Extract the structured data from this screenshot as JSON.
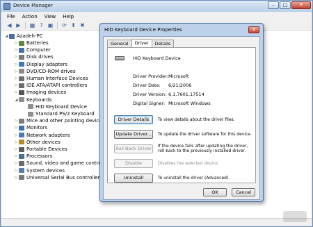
{
  "window": {
    "title": "Device Manager"
  },
  "menu": [
    "File",
    "Action",
    "View",
    "Help"
  ],
  "toolbar": {
    "icons": [
      "back-icon",
      "forward-icon",
      "properties-icon",
      "help-icon",
      "computer-icon",
      "scan-icon",
      "update-icon",
      "disable-icon"
    ]
  },
  "tree": {
    "root": "Azadeh-PC",
    "items": [
      {
        "label": "Batteries",
        "icon": "battery-icon",
        "color": "#5a8a3a",
        "expanded": false
      },
      {
        "label": "Computer",
        "icon": "computer-icon",
        "color": "#4a6fa5",
        "expanded": false
      },
      {
        "label": "Disk drives",
        "icon": "disk-icon",
        "color": "#7a7a7a",
        "expanded": false
      },
      {
        "label": "Display adapters",
        "icon": "display-icon",
        "color": "#3e7ab8",
        "expanded": false
      },
      {
        "label": "DVD/CD-ROM drives",
        "icon": "dvd-icon",
        "color": "#8a8a8a",
        "expanded": false
      },
      {
        "label": "Human Interface Devices",
        "icon": "hid-icon",
        "color": "#6e6e6e",
        "expanded": false
      },
      {
        "label": "IDE ATA/ATAPI controllers",
        "icon": "ide-icon",
        "color": "#6b6b6b",
        "expanded": false
      },
      {
        "label": "Imaging devices",
        "icon": "camera-icon",
        "color": "#555555",
        "expanded": false
      },
      {
        "label": "Keyboards",
        "icon": "keyboard-icon",
        "color": "#8f8f8f",
        "expanded": true
      },
      {
        "label": "HID Keyboard Device",
        "icon": "keyboard-icon",
        "color": "#8f8f8f",
        "child": true
      },
      {
        "label": "Standard PS/2 Keyboard",
        "icon": "keyboard-icon",
        "color": "#8f8f8f",
        "child": true
      },
      {
        "label": "Mice and other pointing devices",
        "icon": "mouse-icon",
        "color": "#7c7c7c",
        "expanded": false
      },
      {
        "label": "Monitors",
        "icon": "monitor-icon",
        "color": "#3f6fa8",
        "expanded": false
      },
      {
        "label": "Network adapters",
        "icon": "network-icon",
        "color": "#4b7bb3",
        "expanded": false
      },
      {
        "label": "Other devices",
        "icon": "other-devices-icon",
        "color": "#b08a2e",
        "expanded": false
      },
      {
        "label": "Portable Devices",
        "icon": "portable-icon",
        "color": "#5c5c5c",
        "expanded": false
      },
      {
        "label": "Processors",
        "icon": "processor-icon",
        "color": "#4d6f8f",
        "expanded": false
      },
      {
        "label": "Sound, video and game controllers",
        "icon": "sound-icon",
        "color": "#6a6a6a",
        "expanded": false
      },
      {
        "label": "System devices",
        "icon": "system-icon",
        "color": "#5a7ea8",
        "expanded": false
      },
      {
        "label": "Universal Serial Bus controllers",
        "icon": "usb-icon",
        "color": "#7a7a7a",
        "expanded": false
      }
    ]
  },
  "dialog": {
    "title": "HID Keyboard Device Properties",
    "tabs": [
      "General",
      "Driver",
      "Details"
    ],
    "active_tab": "Driver",
    "device_name": "HID Keyboard Device",
    "properties": [
      {
        "label": "Driver Provider:",
        "value": "Microsoft"
      },
      {
        "label": "Driver Date:",
        "value": "6/21/2006"
      },
      {
        "label": "Driver Version:",
        "value": "6.1.7601.17514"
      },
      {
        "label": "Digital Signer:",
        "value": "Microsoft Windows"
      }
    ],
    "actions": [
      {
        "label": "Driver Details",
        "description": "To view details about the driver files.",
        "enabled": true,
        "focused": true
      },
      {
        "label": "Update Driver...",
        "description": "To update the driver software for this device.",
        "enabled": true
      },
      {
        "label": "Roll Back Driver",
        "description": "If the device fails after updating the driver, roll back to the previously installed driver.",
        "enabled": false
      },
      {
        "label": "Disable",
        "description": "Disables the selected device.",
        "enabled": false
      },
      {
        "label": "Uninstall",
        "description": "To uninstall the driver (Advanced).",
        "enabled": true
      }
    ],
    "ok_label": "OK",
    "cancel_label": "Cancel"
  }
}
